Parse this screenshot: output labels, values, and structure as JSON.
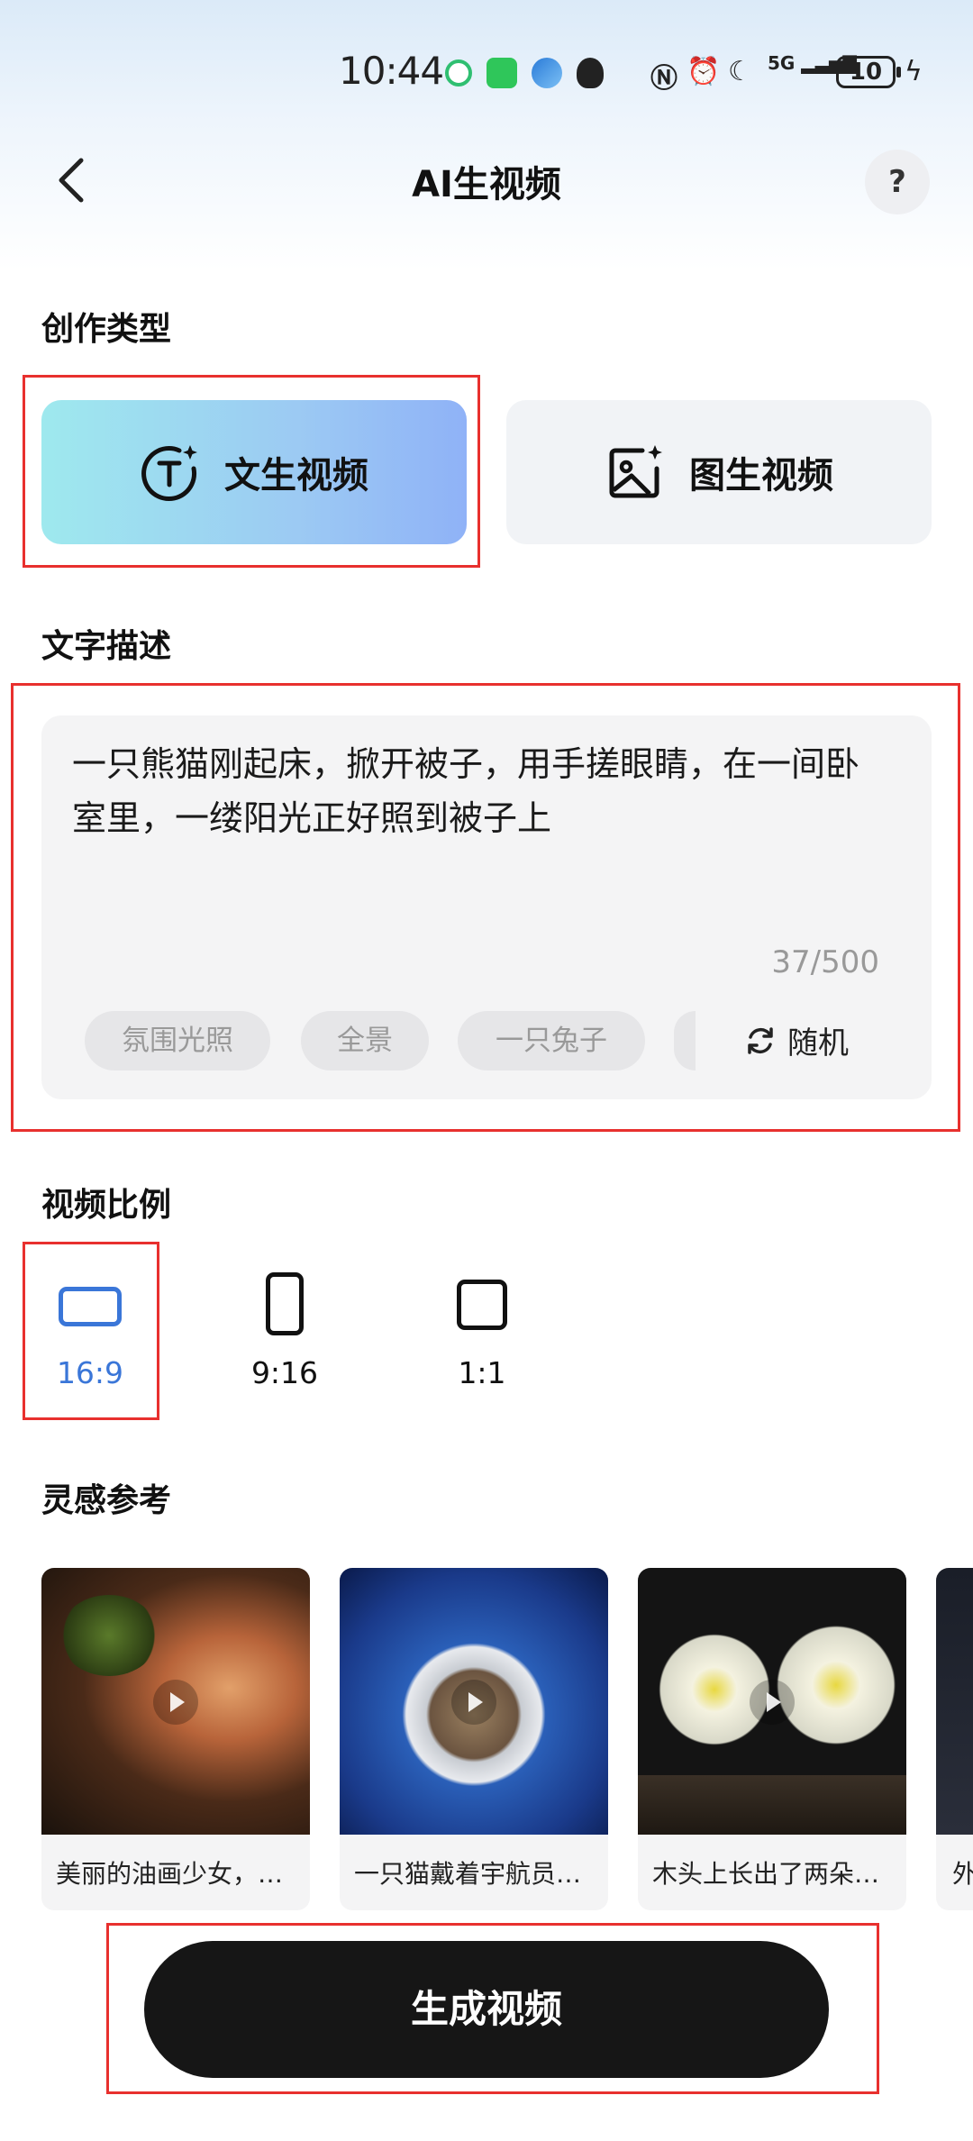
{
  "status_bar": {
    "time": "10:44",
    "battery": "10",
    "network": "5G"
  },
  "header": {
    "title": "AI生视频",
    "help_label": "?"
  },
  "creation_type": {
    "section_title": "创作类型",
    "options": [
      {
        "label": "文生视频",
        "icon": "text-sparkle-icon",
        "selected": true
      },
      {
        "label": "图生视频",
        "icon": "image-sparkle-icon",
        "selected": false
      }
    ]
  },
  "text_description": {
    "section_title": "文字描述",
    "value": "一只熊猫刚起床，掀开被子，用手搓眼睛，在一间卧室里，一缕阳光正好照到被子上",
    "counter": "37/500",
    "chips": [
      "氛围光照",
      "全景",
      "一只兔子"
    ],
    "random_label": "随机"
  },
  "video_ratio": {
    "section_title": "视频比例",
    "options": [
      {
        "label": "16:9",
        "selected": true
      },
      {
        "label": "9:16",
        "selected": false
      },
      {
        "label": "1:1",
        "selected": false
      }
    ]
  },
  "inspiration": {
    "section_title": "灵感参考",
    "cards": [
      {
        "caption": "美丽的油画少女，…"
      },
      {
        "caption": "一只猫戴着宇航员…"
      },
      {
        "caption": "木头上长出了两朵…"
      },
      {
        "caption": "外"
      }
    ]
  },
  "generate_button": {
    "label": "生成视频"
  },
  "colors": {
    "accent_blue": "#3a76d8",
    "highlight_red": "#e8302e",
    "button_dark": "#161616"
  }
}
